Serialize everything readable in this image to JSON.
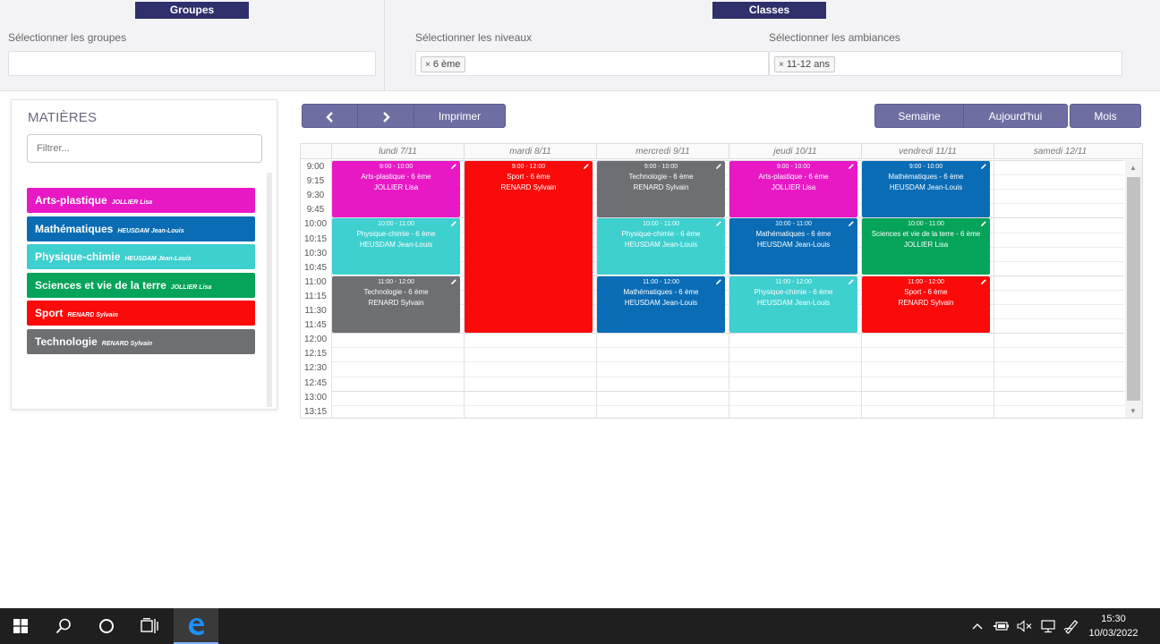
{
  "filters": {
    "groups_tab": "Groupes",
    "classes_tab": "Classes",
    "groups_label": "Sélectionner les groupes",
    "levels_label": "Sélectionner les niveaux",
    "levels_chip": "6 ème",
    "ambiances_label": "Sélectionner les ambiances",
    "ambiances_chip": "11-12 ans",
    "chip_remove": "×"
  },
  "subjects_panel": {
    "title": "MATIÈRES",
    "filter_placeholder": "Filtrer...",
    "items": [
      {
        "name": "Arts-plastique",
        "teacher": "JOLLIER Lisa",
        "color": "#e819c5"
      },
      {
        "name": "Mathématiques",
        "teacher": "HEUSDAM Jean-Louis",
        "color": "#0a6cb4"
      },
      {
        "name": "Physique-chimie",
        "teacher": "HEUSDAM Jean-Louis",
        "color": "#3ecfcf"
      },
      {
        "name": "Sciences et vie de la terre",
        "teacher": "JOLLIER Lisa",
        "color": "#05a45a"
      },
      {
        "name": "Sport",
        "teacher": "RENARD Sylvain",
        "color": "#fb0a0a"
      },
      {
        "name": "Technologie",
        "teacher": "RENARD Sylvain",
        "color": "#6d6f72"
      }
    ]
  },
  "toolbar": {
    "prev_icon": "chevron-left-icon",
    "next_icon": "chevron-right-icon",
    "print_label": "Imprimer",
    "week_label": "Semaine",
    "today_label": "Aujourd'hui",
    "month_label": "Mois"
  },
  "calendar": {
    "days": [
      "lundi 7/11",
      "mardi 8/11",
      "mercredi 9/11",
      "jeudi 10/11",
      "vendredi 11/11",
      "samedi 12/11"
    ],
    "times": [
      "9:00",
      "9:15",
      "9:30",
      "9:45",
      "10:00",
      "10:15",
      "10:30",
      "10:45",
      "11:00",
      "11:15",
      "11:30",
      "11:45",
      "12:00",
      "12:15",
      "12:30",
      "12:45",
      "13:00",
      "13:15"
    ],
    "events": [
      {
        "day": 0,
        "start": "9:00",
        "end": "10:00",
        "time": "9:00 - 10:00",
        "subject": "Arts-plastique - 6 ème",
        "teacher": "JOLLIER Lisa",
        "color": "#e819c5"
      },
      {
        "day": 0,
        "start": "10:00",
        "end": "11:00",
        "time": "10:00 - 11:00",
        "subject": "Physique-chimie - 6 ème",
        "teacher": "HEUSDAM Jean-Louis",
        "color": "#3ecfcf"
      },
      {
        "day": 0,
        "start": "11:00",
        "end": "12:00",
        "time": "11:00 - 12:00",
        "subject": "Technologie - 6 ème",
        "teacher": "RENARD Sylvain",
        "color": "#6d6f72"
      },
      {
        "day": 1,
        "start": "9:00",
        "end": "12:00",
        "time": "9:00 - 12:00",
        "subject": "Sport - 6 ème",
        "teacher": "RENARD Sylvain",
        "color": "#fb0a0a"
      },
      {
        "day": 2,
        "start": "9:00",
        "end": "10:00",
        "time": "9:00 - 10:00",
        "subject": "Technologie - 6 ème",
        "teacher": "RENARD Sylvain",
        "color": "#6d6f72"
      },
      {
        "day": 2,
        "start": "10:00",
        "end": "11:00",
        "time": "10:00 - 11:00",
        "subject": "Physique-chimie - 6 ème",
        "teacher": "HEUSDAM Jean-Louis",
        "color": "#3ecfcf"
      },
      {
        "day": 2,
        "start": "11:00",
        "end": "12:00",
        "time": "11:00 - 12:00",
        "subject": "Mathématiques - 6 ème",
        "teacher": "HEUSDAM Jean-Louis",
        "color": "#0a6cb4"
      },
      {
        "day": 3,
        "start": "9:00",
        "end": "10:00",
        "time": "9:00 - 10:00",
        "subject": "Arts-plastique - 6 ème",
        "teacher": "JOLLIER Lisa",
        "color": "#e819c5"
      },
      {
        "day": 3,
        "start": "10:00",
        "end": "11:00",
        "time": "10:00 - 11:00",
        "subject": "Mathématiques - 6 ème",
        "teacher": "HEUSDAM Jean-Louis",
        "color": "#0a6cb4"
      },
      {
        "day": 3,
        "start": "11:00",
        "end": "12:00",
        "time": "11:00 - 12:00",
        "subject": "Physique-chimie - 6 ème",
        "teacher": "HEUSDAM Jean-Louis",
        "color": "#3ecfcf"
      },
      {
        "day": 4,
        "start": "9:00",
        "end": "10:00",
        "time": "9:00 - 10:00",
        "subject": "Mathématiques - 6 ème",
        "teacher": "HEUSDAM Jean-Louis",
        "color": "#0a6cb4"
      },
      {
        "day": 4,
        "start": "10:00",
        "end": "11:00",
        "time": "10:00 - 11:00",
        "subject": "Sciences et vie de la terre - 6 ème",
        "teacher": "JOLLIER Lisa",
        "color": "#05a45a"
      },
      {
        "day": 4,
        "start": "11:00",
        "end": "12:00",
        "time": "11:00 - 12:00",
        "subject": "Sport - 6 ème",
        "teacher": "RENARD Sylvain",
        "color": "#fb0a0a"
      }
    ]
  },
  "taskbar": {
    "icons": [
      "windows-start-icon",
      "search-icon",
      "cortana-icon",
      "task-view-icon",
      "edge-browser-icon"
    ],
    "tray_icons": [
      "chevron-up-icon",
      "battery-icon",
      "volume-muted-icon",
      "network-icon",
      "pen-icon"
    ],
    "time": "15:30",
    "date": "10/03/2022"
  }
}
